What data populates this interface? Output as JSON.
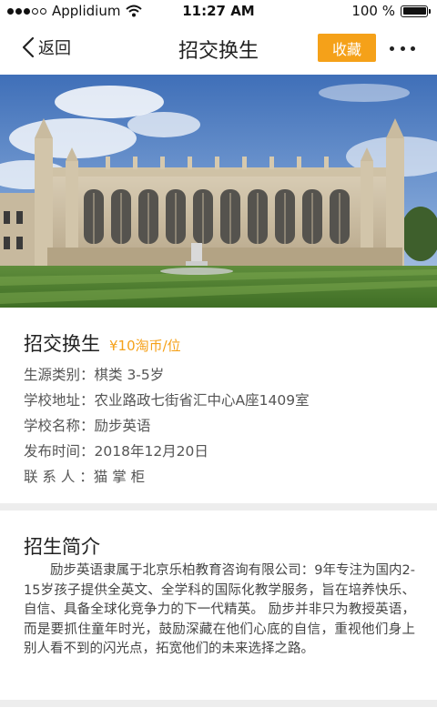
{
  "status_bar": {
    "carrier": "Applidium",
    "time": "11:27 AM",
    "battery_text": "100 %",
    "battery_level": 1.0
  },
  "nav": {
    "back_label": "返回",
    "title": "招交换生",
    "favorite_label": "收藏",
    "more_icon": "more-icon"
  },
  "hero": {
    "image": "kings-college-chapel-photo"
  },
  "info": {
    "title": "招交换生",
    "price": "¥10淘币/位",
    "rows": [
      {
        "label": "生源类别：",
        "value": "棋类 3-5岁"
      },
      {
        "label": "学校地址：",
        "value": "农业路政七街省汇中心A座1409室"
      },
      {
        "label": "学校名称：",
        "value": "励步英语"
      },
      {
        "label": "发布时间：",
        "value": "2018年12月20日"
      },
      {
        "label": "联 系 人 ：",
        "value": "猫 掌 柜"
      }
    ]
  },
  "intro": {
    "title": "招生简介",
    "body": "励步英语隶属于北京乐柏教育咨询有限公司：9年专注为国内2-15岁孩子提供全英文、全学科的国际化教学服务，旨在培养快乐、自信、具备全球化竞争力的下一代精英。 励步并非只为教授英语，而是要抓住童年时光，鼓励深藏在他们心底的自信，重视他们身上别人看不到的闪光点，拓宽他们的未来选择之路。"
  },
  "colors": {
    "accent": "#f5a119",
    "divider": "#ededed",
    "text": "#333333"
  }
}
